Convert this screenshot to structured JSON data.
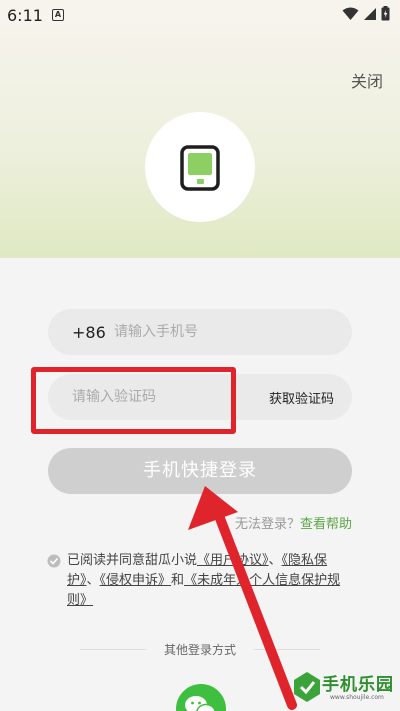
{
  "status_bar": {
    "time": "6:11",
    "notification_badge": "A"
  },
  "header": {
    "close_label": "关闭",
    "accent_color": "#8ccf63"
  },
  "phone": {
    "country_code": "+86",
    "placeholder": "请输入手机号"
  },
  "code": {
    "placeholder": "请输入验证码",
    "get_code_label": "获取验证码"
  },
  "login": {
    "button_label": "手机快捷登录"
  },
  "help": {
    "question_partial": "无法登录？",
    "link_label": "查看帮助"
  },
  "agreement": {
    "prefix": "已阅读并同意甜瓜小说",
    "user_agreement": "《用户协议》",
    "separator1": "、",
    "privacy": "《隐私保护》",
    "separator2": "、",
    "infringement": "《侵权申诉》",
    "conjunction": "和",
    "minors": "《未成年人个人信息保护规则》"
  },
  "other_login": {
    "label": "其他登录方式",
    "icons": [
      "wechat-icon"
    ]
  },
  "annotation": {
    "highlight_color": "#e0242c"
  },
  "watermark": {
    "title": "手机乐园",
    "url": "www.shoujile.com"
  }
}
